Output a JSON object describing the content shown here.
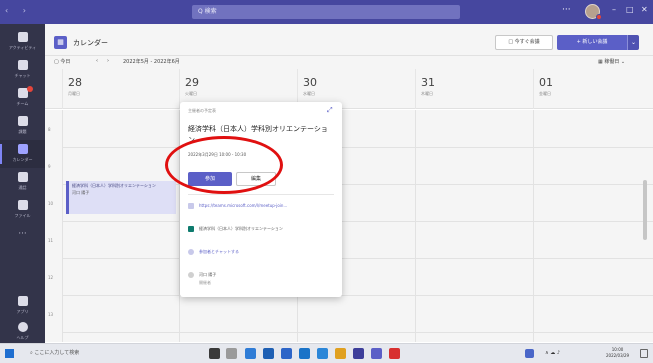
{
  "titlebar": {
    "nav_arrows": "‹ ›",
    "search_placeholder": "Q 検索",
    "more": "···",
    "win_min": "–",
    "win_max": "□",
    "win_close": "✕"
  },
  "rail": {
    "items": [
      {
        "label": "アクティビティ",
        "icon": "bell-icon"
      },
      {
        "label": "チャット",
        "icon": "chat-icon"
      },
      {
        "label": "チーム",
        "icon": "teams-icon"
      },
      {
        "label": "課題",
        "icon": "assignments-icon"
      },
      {
        "label": "カレンダー",
        "icon": "calendar-icon"
      },
      {
        "label": "通話",
        "icon": "phone-icon"
      },
      {
        "label": "ファイル",
        "icon": "files-icon"
      },
      {
        "label": "···",
        "icon": "more-icon"
      },
      {
        "label": "アプリ",
        "icon": "apps-icon"
      },
      {
        "label": "ヘルプ",
        "icon": "help-icon"
      }
    ]
  },
  "header": {
    "app_title": "カレンダー",
    "meet_now": "□ 今すぐ会議",
    "new_meeting": "+ 新しい会議"
  },
  "toolbar": {
    "today": "今日",
    "range": "2022年5月 - 2022年6月",
    "view": "稼働日"
  },
  "days": [
    {
      "num": "28",
      "name": "月曜日"
    },
    {
      "num": "29",
      "name": "火曜日"
    },
    {
      "num": "30",
      "name": "水曜日"
    },
    {
      "num": "31",
      "name": "木曜日"
    },
    {
      "num": "01",
      "name": "金曜日"
    }
  ],
  "hours": [
    "8",
    "9",
    "10",
    "11",
    "12",
    "13"
  ],
  "event": {
    "title": "経済学科（日本人）学科別オリエンテーション",
    "organizer": "河口 陽子"
  },
  "popup": {
    "subtitle": "主催者の予定表",
    "title": "経済学科（日本人）学科別オリエンテーション",
    "time": "2022年3月29日 10:00 - 10:30",
    "join": "参加",
    "edit": "編集",
    "link": "https://teams.microsoft.com/l/meetup-join...",
    "channel": "経済学科（日本人）学科別オリエンテーション",
    "chat": "参加者とチャットする",
    "organizer_name": "河口 陽子",
    "organizer_role": "開催者"
  },
  "taskbar": {
    "search": "ここに入力して検索",
    "tray": "∧ ☁ ♪",
    "time": "10:00",
    "date": "2022/03/29"
  },
  "colors": {
    "brand": "#5b5fc7",
    "titlebar": "#46479f",
    "rail": "#33344a",
    "annotation": "#e01010"
  }
}
